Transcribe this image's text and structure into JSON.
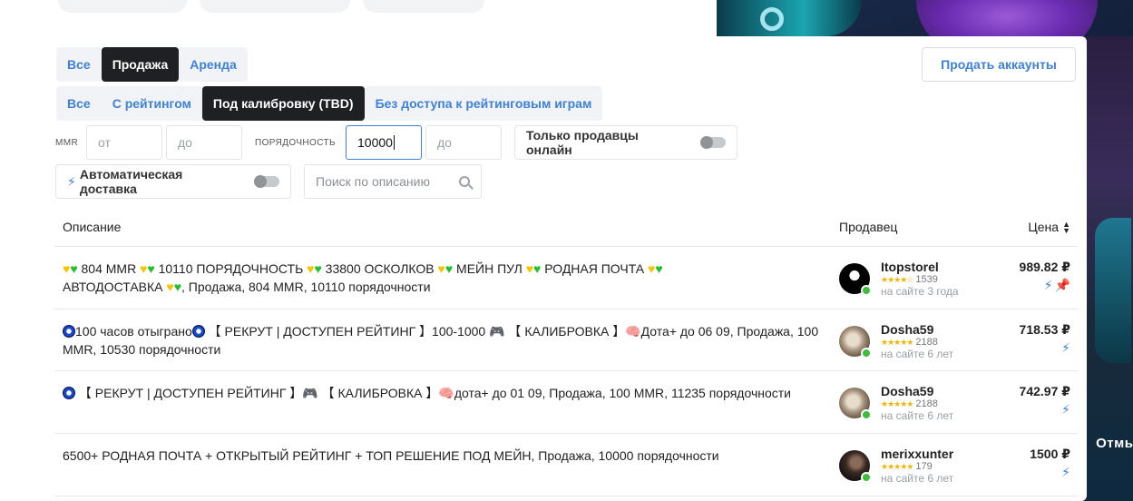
{
  "top_tabs": [
    "Все",
    "Продажа",
    "Аренда"
  ],
  "top_tabs_active": 1,
  "sub_tabs": [
    "Все",
    "С рейтингом",
    "Под калибровку (TBD)",
    "Без доступа к рейтинговым играм"
  ],
  "sub_tabs_active": 2,
  "sell_button": "Продать аккаунты",
  "filters": {
    "mmr_label": "MMR",
    "mmr_from_placeholder": "от",
    "mmr_to_placeholder": "до",
    "order_label": "ПОРЯДОЧНОСТЬ",
    "order_from_value": "10000",
    "order_to_placeholder": "до",
    "online_only": "Только продавцы онлайн",
    "auto_delivery": "Автоматическая доставка",
    "search_placeholder": "Поиск по описанию"
  },
  "table": {
    "headers": {
      "description": "Описание",
      "seller": "Продавец",
      "price": "Цена"
    },
    "rows": [
      {
        "desc_a": " 804 MMR ",
        "desc_b": " 10110 ПОРЯДОЧНОСТЬ ",
        "desc_c": " 33800 ОСКОЛКОВ ",
        "desc_d": " МЕЙН ПУЛ ",
        "desc_e": " РОДНАЯ ПОЧТА ",
        "desc_f": "АВТОДОСТАВКА ",
        "desc_g": ", Продажа, 804 MMR, 10110 порядочности",
        "seller": "Itopstorel",
        "stars": "★★★★☆",
        "rating_count": "1539",
        "since": "на сайте 3 года",
        "price": "989.82 ₽"
      },
      {
        "desc_a": "100 часов отыграно",
        "desc_b": " 【 РЕКРУТ | ДОСТУПЕН РЕЙТИНГ 】100-1000 ",
        "desc_c": " 【 КАЛИБРОВКА 】",
        "desc_d": "Дота+ до 06 09, Продажа, 100 MMR, 10530 порядочности",
        "seller": "Dosha59",
        "stars": "★★★★★",
        "rating_count": "2188",
        "since": "на сайте 6 лет",
        "price": "718.53 ₽"
      },
      {
        "desc_a": " 【 РЕКРУТ | ДОСТУПЕН РЕЙТИНГ 】",
        "desc_b": " 【 КАЛИБРОВКА 】",
        "desc_c": "дота+ до 01 09, Продажа, 100 MMR, 11235 порядочности",
        "seller": "Dosha59",
        "stars": "★★★★★",
        "rating_count": "2188",
        "since": "на сайте 6 лет",
        "price": "742.97 ₽"
      },
      {
        "desc_a": "6500+ РОДНАЯ ПОЧТА + ОТКРЫТЫЙ РЕЙТИНГ + ТОП РЕШЕНИЕ ПОД МЕЙН, Продажа, 10000 порядочности",
        "seller": "merixxunter",
        "stars": "★★★★★",
        "rating_count": "179",
        "since": "на сайте 6 лет",
        "price": "1500 ₽"
      }
    ]
  },
  "promo_text": "Отмы",
  "colors": {
    "accent": "#3d82d6",
    "active_tab": "#1f2023",
    "online": "#3cbe3c"
  }
}
